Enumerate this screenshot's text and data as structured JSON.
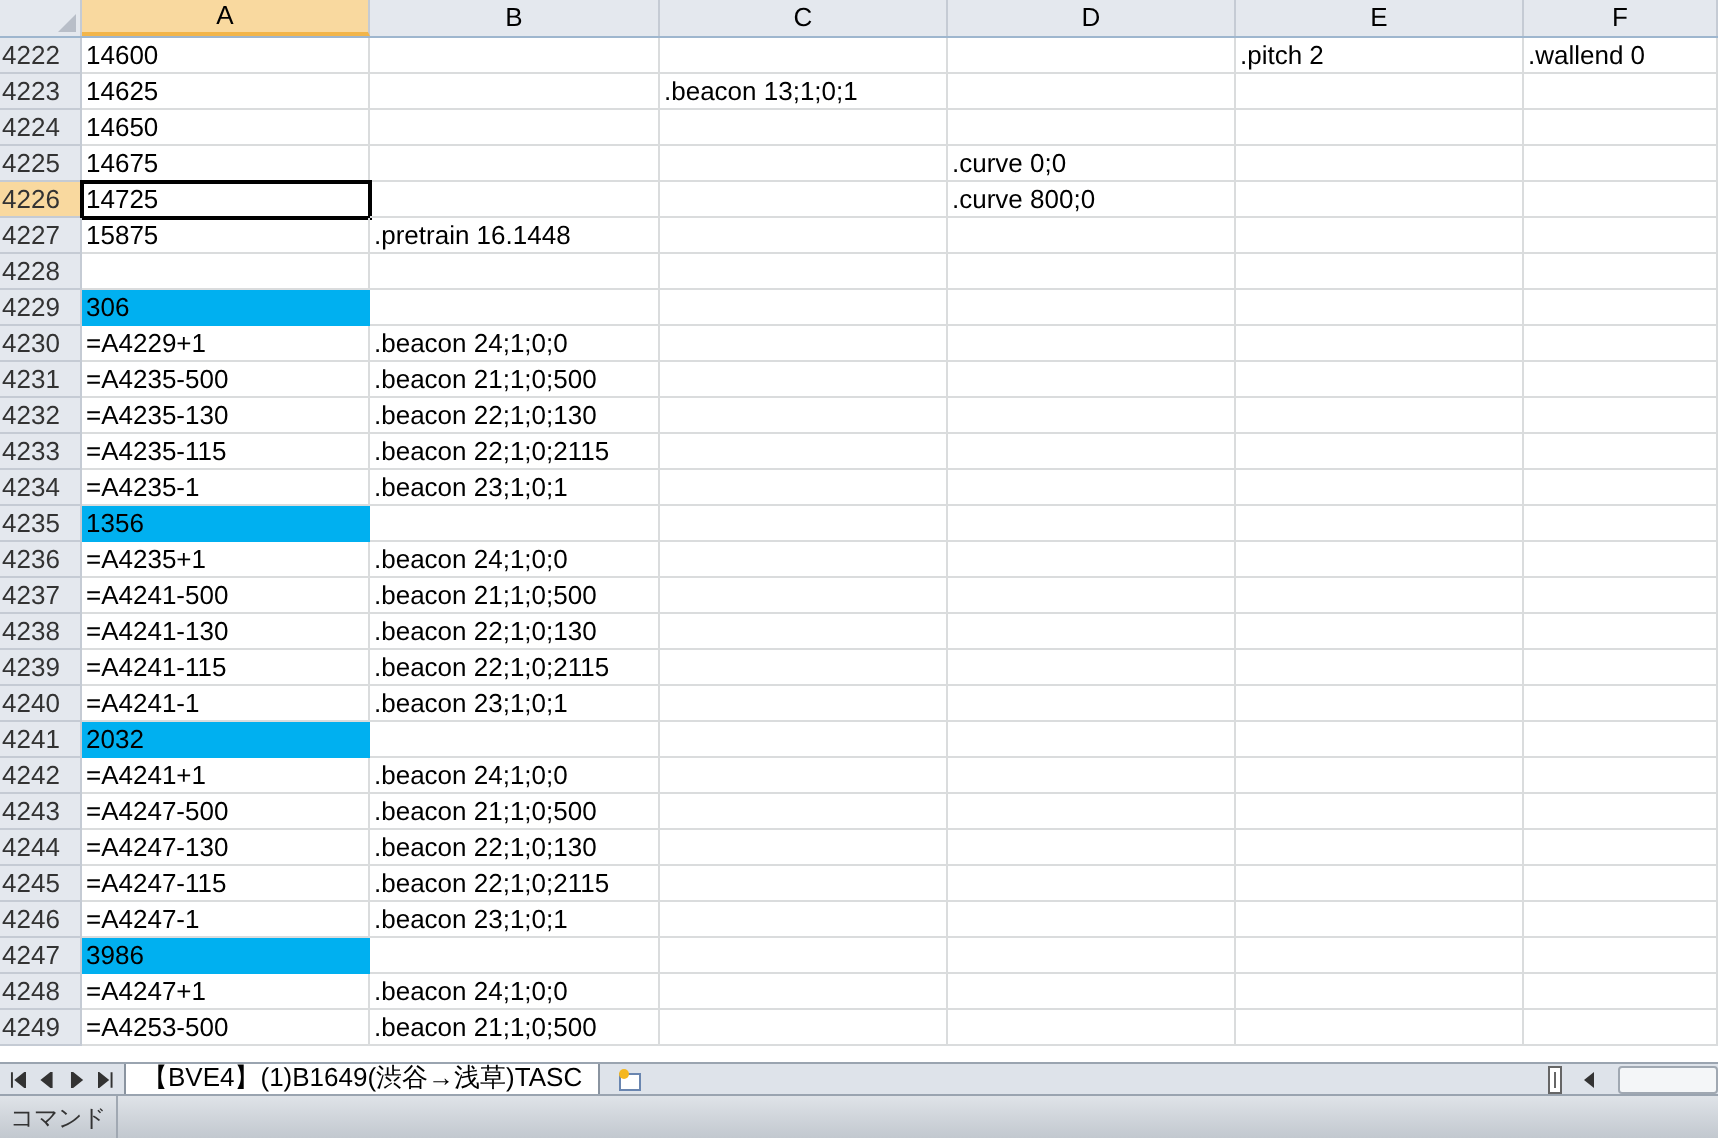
{
  "columns": [
    {
      "label": "A",
      "selected": true
    },
    {
      "label": "B",
      "selected": false
    },
    {
      "label": "C",
      "selected": false
    },
    {
      "label": "D",
      "selected": false
    },
    {
      "label": "E",
      "selected": false
    },
    {
      "label": "F",
      "selected": false
    }
  ],
  "rows": [
    {
      "number": "4222",
      "selected": false,
      "cells": {
        "a": {
          "text": "14600"
        },
        "e": {
          "text": ".pitch 2"
        },
        "f": {
          "text": ".wallend 0"
        }
      }
    },
    {
      "number": "4223",
      "selected": false,
      "cells": {
        "a": {
          "text": "14625"
        },
        "c": {
          "text": ".beacon 13;1;0;1"
        }
      }
    },
    {
      "number": "4224",
      "selected": false,
      "cells": {
        "a": {
          "text": "14650"
        }
      }
    },
    {
      "number": "4225",
      "selected": false,
      "cells": {
        "a": {
          "text": "14675"
        },
        "d": {
          "text": ".curve 0;0"
        }
      }
    },
    {
      "number": "4226",
      "selected": true,
      "cells": {
        "a": {
          "text": "14725"
        },
        "d": {
          "text": ".curve 800;0"
        }
      }
    },
    {
      "number": "4227",
      "selected": false,
      "cells": {
        "a": {
          "text": "15875"
        },
        "b": {
          "text": ".pretrain 16.1448"
        }
      }
    },
    {
      "number": "4228",
      "selected": false,
      "cells": {}
    },
    {
      "number": "4229",
      "selected": false,
      "cells": {
        "a": {
          "text": "306",
          "color": "#00b0f0"
        }
      }
    },
    {
      "number": "4230",
      "selected": false,
      "cells": {
        "a": {
          "text": "=A4229+1"
        },
        "b": {
          "text": ".beacon 24;1;0;0"
        }
      }
    },
    {
      "number": "4231",
      "selected": false,
      "cells": {
        "a": {
          "text": "=A4235-500"
        },
        "b": {
          "text": ".beacon 21;1;0;500"
        }
      }
    },
    {
      "number": "4232",
      "selected": false,
      "cells": {
        "a": {
          "text": "=A4235-130"
        },
        "b": {
          "text": ".beacon 22;1;0;130"
        }
      }
    },
    {
      "number": "4233",
      "selected": false,
      "cells": {
        "a": {
          "text": "=A4235-115"
        },
        "b": {
          "text": ".beacon 22;1;0;2115"
        }
      }
    },
    {
      "number": "4234",
      "selected": false,
      "cells": {
        "a": {
          "text": "=A4235-1"
        },
        "b": {
          "text": ".beacon 23;1;0;1"
        }
      }
    },
    {
      "number": "4235",
      "selected": false,
      "cells": {
        "a": {
          "text": "1356",
          "color": "#00b0f0"
        }
      }
    },
    {
      "number": "4236",
      "selected": false,
      "cells": {
        "a": {
          "text": "=A4235+1"
        },
        "b": {
          "text": ".beacon 24;1;0;0"
        }
      }
    },
    {
      "number": "4237",
      "selected": false,
      "cells": {
        "a": {
          "text": "=A4241-500"
        },
        "b": {
          "text": ".beacon 21;1;0;500"
        }
      }
    },
    {
      "number": "4238",
      "selected": false,
      "cells": {
        "a": {
          "text": "=A4241-130"
        },
        "b": {
          "text": ".beacon 22;1;0;130"
        }
      }
    },
    {
      "number": "4239",
      "selected": false,
      "cells": {
        "a": {
          "text": "=A4241-115"
        },
        "b": {
          "text": ".beacon 22;1;0;2115"
        }
      }
    },
    {
      "number": "4240",
      "selected": false,
      "cells": {
        "a": {
          "text": "=A4241-1"
        },
        "b": {
          "text": ".beacon 23;1;0;1"
        }
      }
    },
    {
      "number": "4241",
      "selected": false,
      "cells": {
        "a": {
          "text": "2032",
          "color": "#00b0f0"
        }
      }
    },
    {
      "number": "4242",
      "selected": false,
      "cells": {
        "a": {
          "text": "=A4241+1"
        },
        "b": {
          "text": ".beacon 24;1;0;0"
        }
      }
    },
    {
      "number": "4243",
      "selected": false,
      "cells": {
        "a": {
          "text": "=A4247-500"
        },
        "b": {
          "text": ".beacon 21;1;0;500"
        }
      }
    },
    {
      "number": "4244",
      "selected": false,
      "cells": {
        "a": {
          "text": "=A4247-130"
        },
        "b": {
          "text": ".beacon 22;1;0;130"
        }
      }
    },
    {
      "number": "4245",
      "selected": false,
      "cells": {
        "a": {
          "text": "=A4247-115"
        },
        "b": {
          "text": ".beacon 22;1;0;2115"
        }
      }
    },
    {
      "number": "4246",
      "selected": false,
      "cells": {
        "a": {
          "text": "=A4247-1"
        },
        "b": {
          "text": ".beacon 23;1;0;1"
        }
      }
    },
    {
      "number": "4247",
      "selected": false,
      "cells": {
        "a": {
          "text": "3986",
          "color": "#00b0f0"
        }
      }
    },
    {
      "number": "4248",
      "selected": false,
      "cells": {
        "a": {
          "text": "=A4247+1"
        },
        "b": {
          "text": ".beacon 24;1;0;0"
        }
      }
    },
    {
      "number": "4249",
      "selected": false,
      "cells": {
        "a": {
          "text": "=A4253-500"
        },
        "b": {
          "text": ".beacon 21;1;0;500"
        }
      }
    }
  ],
  "sheet_tabs": [
    {
      "label": "【BVE4】(1)B1649(渋谷→浅草)TASC",
      "selected": true
    }
  ],
  "status_bar": {
    "mode": "コマンド"
  }
}
